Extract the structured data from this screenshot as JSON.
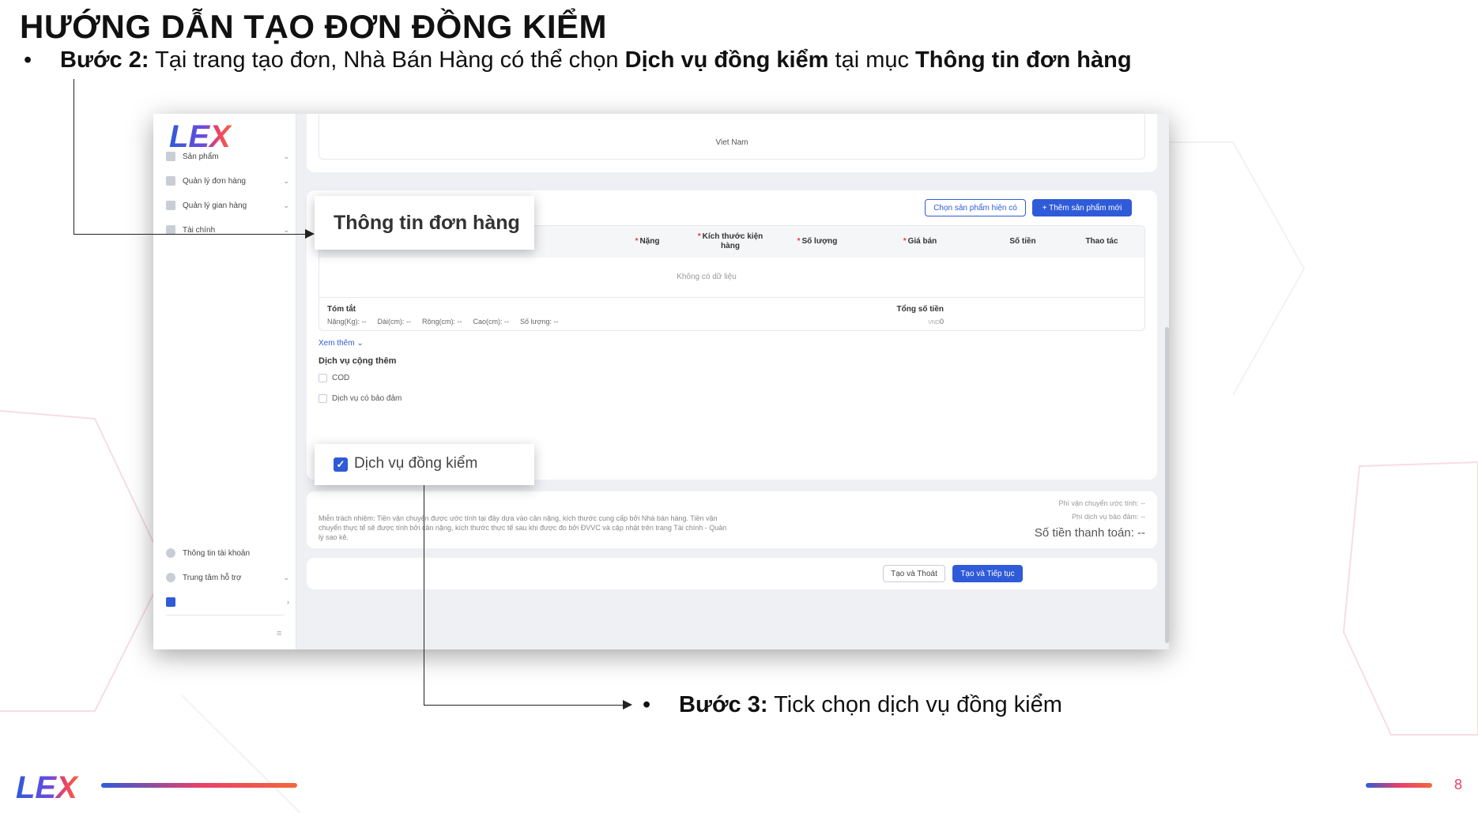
{
  "slide": {
    "title": "HƯỚNG DẪN TẠO ĐƠN ĐỒNG KIỂM",
    "step2": {
      "bullet": "•",
      "label": "Bước 2:",
      "text1": " Tại trang tạo đơn, Nhà Bán Hàng có thể chọn ",
      "bold1": "Dịch vụ đồng kiểm",
      "text2": " tại mục ",
      "bold2": "Thông tin đơn hàng"
    },
    "step3": {
      "bullet": "•",
      "label": "Bước 3:",
      "text": " Tick chọn dịch vụ đồng kiểm"
    },
    "callout_order_info": "Thông tin đơn hàng",
    "callout_checkbox_label": "Dịch vụ đồng kiểm",
    "page_number": "8",
    "brand_logo": "LEX"
  },
  "sidebar": {
    "logo": "LEX",
    "items": [
      {
        "label": "Sản phẩm",
        "icon": "box-icon"
      },
      {
        "label": "Quản lý đơn hàng",
        "icon": "orders-icon"
      },
      {
        "label": "Quản lý gian hàng",
        "icon": "store-icon"
      },
      {
        "label": "Tài chính",
        "icon": "wallet-icon"
      }
    ],
    "bottom_items": [
      {
        "label": "Thông tin tài khoản",
        "icon": "user-icon"
      },
      {
        "label": "Trung tâm hỗ trợ",
        "icon": "help-icon"
      }
    ]
  },
  "address": {
    "country": "Viet Nam"
  },
  "order_info": {
    "choose_existing": "Chọn sản phẩm hiện có",
    "add_new": "+ Thêm sản phẩm mới",
    "columns": [
      "Nặng",
      "Kích thước kiện hàng",
      "Số lượng",
      "Giá bán",
      "Số tiền",
      "Thao tác"
    ],
    "empty_text": "Không có dữ liệu",
    "summary_title": "Tóm tắt",
    "summary_fields": [
      "Nặng(Kg): --",
      "Dài(cm): --",
      "Rộng(cm): --",
      "Cao(cm): --",
      "Số lượng: --"
    ],
    "total_title": "Tổng số tiền",
    "total_currency": "VND",
    "total_value": "0",
    "see_more": "Xem thêm",
    "services_title": "Dịch vụ cộng thêm",
    "services": [
      "COD",
      "Dịch vụ có bảo đảm"
    ]
  },
  "payment": {
    "disclaimer": "Miễn trách nhiệm: Tiền vận chuyển được ước tính tại đây dựa vào cân nặng, kích thước cung cấp bởi Nhà bán hàng. Tiền vận chuyển thực tế sẽ được tính bởi cân nặng, kích thước thực tế sau khi được đo bởi ĐVVC và cập nhật trên trang Tài chính - Quản lý sao kê.",
    "shipping_fee": "Phí vận chuyển ước tính: --",
    "insurance_fee": "Phí dịch vụ bảo đảm: --",
    "total_pay": "Số tiền thanh toán: --"
  },
  "actions": {
    "create_exit": "Tạo và Thoát",
    "create_continue": "Tạo và Tiếp tục"
  },
  "colors": {
    "primary": "#2f5bd8",
    "accent": "#e8406b"
  }
}
